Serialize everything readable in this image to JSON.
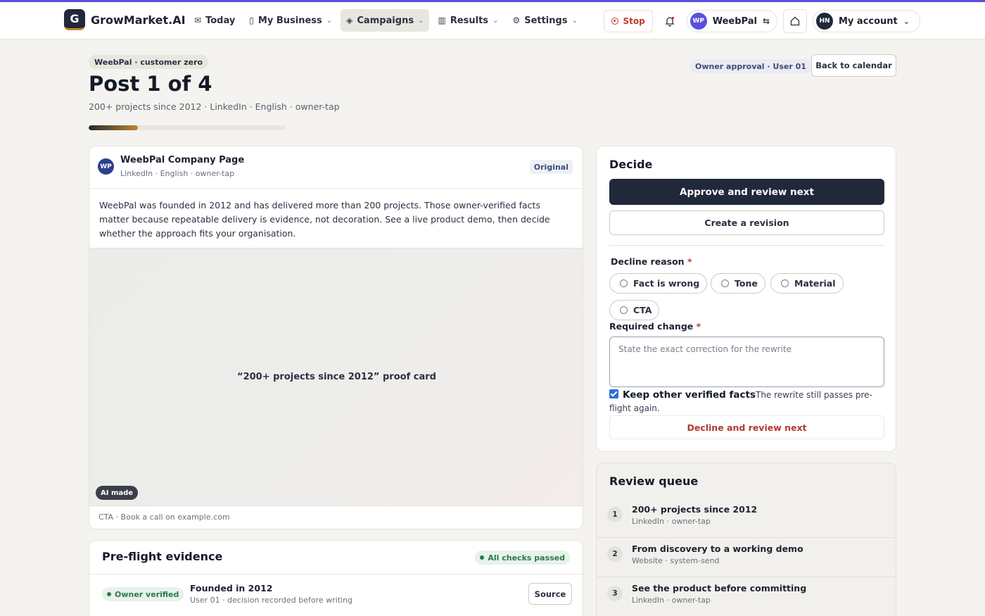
{
  "nav": {
    "brand_letter": "G",
    "brand_name": "GrowMarket.AI",
    "items": [
      {
        "label": "Today"
      },
      {
        "label": "My Business"
      },
      {
        "label": "Campaigns"
      },
      {
        "label": "Results"
      },
      {
        "label": "Settings"
      }
    ],
    "stop_label": "Stop",
    "workspace_initials": "WP",
    "workspace_name": "WeebPal",
    "account_initials": "HN",
    "account_label": "My account"
  },
  "header": {
    "tag": "WeebPal · customer zero",
    "title": "Post 1 of 4",
    "subtitle": "200+ projects since 2012 · LinkedIn · English · owner-tap",
    "progress_fraction": 0.25,
    "owner_approval": "Owner approval · User 01",
    "back_label": "Back to calendar"
  },
  "post": {
    "avatar_initials": "WP",
    "company": "WeebPal Company Page",
    "meta": "LinkedIn · English · owner-tap",
    "badge": "Original",
    "body": "WeebPal was founded in 2012 and has delivered more than 200 projects. Those owner-verified facts matter because repeatable delivery is evidence, not decoration. See a live product demo, then decide whether the approach fits your organisation.",
    "image_caption": "“200+ projects since 2012” proof card",
    "ai_badge": "AI made",
    "cta": "CTA · Book a call on example.com"
  },
  "evidence": {
    "title": "Pre-flight evidence",
    "status": "All checks passed",
    "rows": [
      {
        "badge": "Owner verified",
        "fact": "Founded in 2012",
        "meta": "User 01 · decision recorded before writing",
        "action": "Source"
      }
    ]
  },
  "decide": {
    "title": "Decide",
    "approve_label": "Approve and review next",
    "revision_label": "Create a revision",
    "decline_reason_label": "Decline reason",
    "required_marker": "*",
    "reasons": [
      {
        "label": "Fact is wrong"
      },
      {
        "label": "Tone"
      },
      {
        "label": "Material"
      },
      {
        "label": "CTA"
      }
    ],
    "required_change_label": "Required change",
    "textarea_placeholder": "State the exact correction for the rewrite",
    "keep_label": "Keep other verified facts",
    "keep_hint": "The rewrite still passes pre-flight again.",
    "decline_label": "Decline and review next"
  },
  "queue": {
    "title": "Review queue",
    "items": [
      {
        "num": "1",
        "title": "200+ projects since 2012",
        "meta": "LinkedIn · owner-tap"
      },
      {
        "num": "2",
        "title": "From discovery to a working demo",
        "meta": "Website · system-send"
      },
      {
        "num": "3",
        "title": "See the product before committing",
        "meta": "LinkedIn · owner-tap"
      }
    ]
  },
  "colors": {
    "accent": "#5a4fe0",
    "primary": "#20283a",
    "danger": "#c0392b",
    "success": "#2c7a4a"
  }
}
